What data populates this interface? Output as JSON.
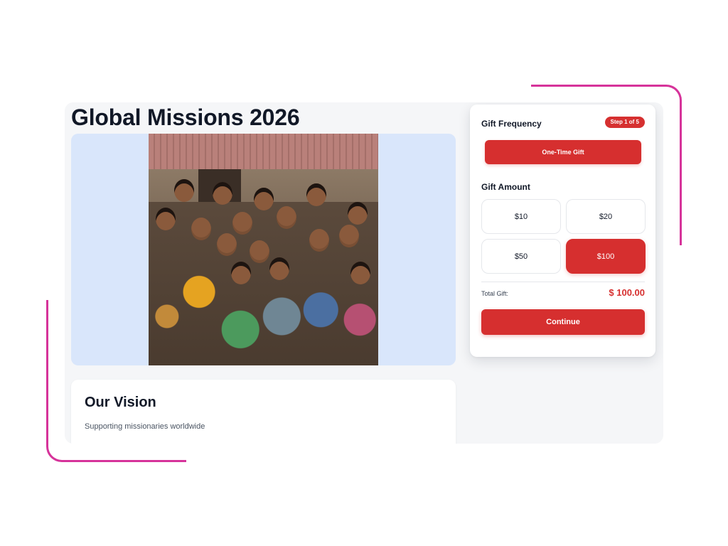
{
  "page": {
    "title": "Global Missions 2026"
  },
  "vision": {
    "title": "Our Vision",
    "text": "Supporting missionaries worldwide"
  },
  "donation": {
    "frequency_title": "Gift Frequency",
    "step_badge": "Step 1 of 5",
    "frequency_option": "One-Time Gift",
    "amount_title": "Gift Amount",
    "amounts": [
      "$10",
      "$20",
      "$50",
      "$100"
    ],
    "selected_amount": "$100",
    "total_label": "Total Gift:",
    "total_value": "$ 100.00",
    "continue_label": "Continue"
  },
  "colors": {
    "accent": "#d62f2f",
    "decoration": "#d6339a",
    "hero_background": "#d9e6fb"
  }
}
